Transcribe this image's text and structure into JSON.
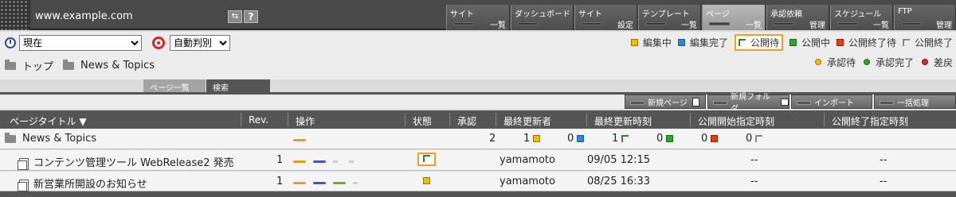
{
  "site": {
    "title": "www.example.com"
  },
  "nav": [
    {
      "top": "サイト",
      "bottom": "一覧"
    },
    {
      "top": "ダッシュボード",
      "bottom": ""
    },
    {
      "top": "サイト",
      "bottom": "設定"
    },
    {
      "top": "テンプレート",
      "bottom": "一覧"
    },
    {
      "top": "ページ",
      "bottom": "一覧"
    },
    {
      "top": "承認依頼",
      "bottom": "管理"
    },
    {
      "top": "スケジュール",
      "bottom": "一覧"
    },
    {
      "top": "FTP",
      "bottom": "管理"
    }
  ],
  "toolbar": {
    "time_value": "現在",
    "judge_value": "自動判別",
    "help_label": "?"
  },
  "legend_status": [
    {
      "label": "編集中",
      "color": "#f0c000"
    },
    {
      "label": "編集完了",
      "color": "#2a8ad8"
    },
    {
      "label": "公開待",
      "color": "#2a8a2a"
    },
    {
      "label": "公開中",
      "color": "#2aa82a"
    },
    {
      "label": "公開終了待",
      "color": "#e04010"
    },
    {
      "label": "公開終了",
      "color": "#888888"
    }
  ],
  "legend_approval": [
    {
      "label": "承認待",
      "color": "#f0c000"
    },
    {
      "label": "承認完了",
      "color": "#2aa82a"
    },
    {
      "label": "差戻",
      "color": "#d03030"
    }
  ],
  "breadcrumb": {
    "home": "トップ",
    "current": "News & Topics"
  },
  "tabs": {
    "list": "ページ一覧",
    "search": "検索"
  },
  "actions": {
    "new_page": "新規ページ",
    "new_folder": "新規フォルダ",
    "import": "インポート",
    "bulk": "一括処理"
  },
  "table": {
    "headers": {
      "title": "ページタイトル ▼",
      "rev": "Rev.",
      "ops": "操作",
      "status": "状態",
      "approval": "承認",
      "updater": "最終更新者",
      "updated": "最終更新時刻",
      "pub_start": "公開開始指定時刻",
      "pub_end": "公開終了指定時刻"
    },
    "folder": {
      "name": "News & Topics",
      "approval_count": "2",
      "counts": [
        "1",
        "0",
        "1",
        "0",
        "0",
        "0"
      ]
    },
    "rows": [
      {
        "title": "コンテンツ管理ツール WebRelease2 発売",
        "rev": "1",
        "updater": "yamamoto",
        "updated": "09/05 12:15",
        "pub_start": "--",
        "pub_end": "--"
      },
      {
        "title": "新営業所開設のお知らせ",
        "rev": "1",
        "updater": "yamamoto",
        "updated": "08/25 16:33",
        "pub_start": "--",
        "pub_end": "--"
      }
    ]
  }
}
